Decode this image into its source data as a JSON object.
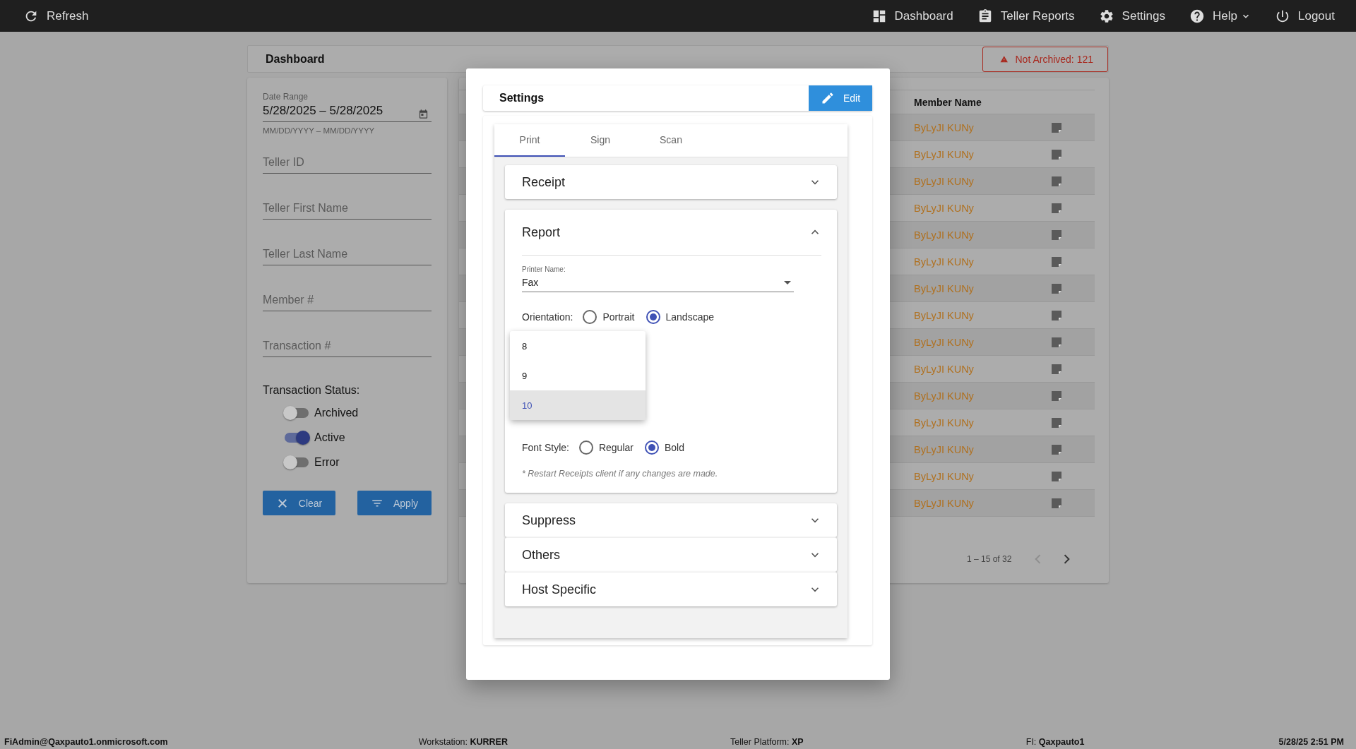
{
  "top_bar": {
    "refresh": "Refresh",
    "nav": [
      {
        "label": "Dashboard",
        "kind": "dashboard"
      },
      {
        "label": "Teller Reports",
        "kind": "reports"
      },
      {
        "label": "Settings",
        "kind": "settings"
      },
      {
        "label": "Help",
        "kind": "help"
      },
      {
        "label": "Logout",
        "kind": "logout"
      }
    ]
  },
  "page_header": {
    "title": "Dashboard",
    "alert": "Not Archived: 121"
  },
  "filters": {
    "date_range": {
      "label": "Date Range",
      "value": "5/28/2025 – 5/28/2025",
      "hint": "MM/DD/YYYY – MM/DD/YYYY"
    },
    "fields": [
      {
        "placeholder": "Teller ID"
      },
      {
        "placeholder": "Teller First Name"
      },
      {
        "placeholder": "Teller Last Name"
      },
      {
        "placeholder": "Member #"
      },
      {
        "placeholder": "Transaction #"
      }
    ],
    "status_label": "Transaction Status:",
    "toggles": [
      {
        "label": "Archived",
        "on": false
      },
      {
        "label": "Active",
        "on": true
      },
      {
        "label": "Error",
        "on": false
      }
    ],
    "buttons": [
      {
        "label": "Clear",
        "kind": "clear"
      },
      {
        "label": "Apply",
        "kind": "apply"
      }
    ]
  },
  "table": {
    "columns": [
      "Member Name"
    ],
    "rows": [
      {
        "member_name": "ByLyJI KUNy"
      },
      {
        "member_name": "ByLyJI KUNy"
      },
      {
        "member_name": "ByLyJI KUNy"
      },
      {
        "member_name": "ByLyJI KUNy"
      },
      {
        "member_name": "ByLyJI KUNy"
      },
      {
        "member_name": "ByLyJI KUNy"
      },
      {
        "member_name": "ByLyJI KUNy"
      },
      {
        "member_name": "ByLyJI KUNy"
      },
      {
        "member_name": "ByLyJI KUNy"
      },
      {
        "member_name": "ByLyJI KUNy"
      },
      {
        "member_name": "ByLyJI KUNy"
      },
      {
        "member_name": "ByLyJI KUNy"
      },
      {
        "member_name": "ByLyJI KUNy"
      },
      {
        "member_name": "ByLyJI KUNy"
      },
      {
        "member_name": "ByLyJI KUNy"
      }
    ],
    "pagination": {
      "range": "1 – 15 of 32",
      "previous_disabled": true,
      "next_disabled": false
    }
  },
  "settings_dialog": {
    "title": "Settings",
    "edit_button": "Edit",
    "tabs": [
      {
        "label": "Print",
        "selected": true
      },
      {
        "label": "Sign",
        "selected": false
      },
      {
        "label": "Scan",
        "selected": false
      }
    ],
    "sections": [
      {
        "title": "Receipt",
        "expanded": false
      },
      {
        "title": "Report",
        "expanded": true,
        "content": {
          "printer_label": "Printer Name:",
          "printer_value": "Fax",
          "orientation": {
            "label": "Orientation:",
            "options": [
              {
                "label": "Portrait",
                "selected": false
              },
              {
                "label": "Landscape",
                "selected": true
              }
            ]
          },
          "font_size_menu": [
            {
              "label": "8",
              "selected": false
            },
            {
              "label": "9",
              "selected": false
            },
            {
              "label": "10",
              "selected": true
            }
          ],
          "font_style": {
            "label": "Font Style:",
            "options": [
              {
                "label": "Regular",
                "selected": false
              },
              {
                "label": "Bold",
                "selected": true
              }
            ]
          },
          "note": "* Restart Receipts client if any changes are made."
        }
      },
      {
        "title": "Suppress",
        "expanded": false
      },
      {
        "title": "Others",
        "expanded": false
      },
      {
        "title": "Host Specific",
        "expanded": false
      }
    ]
  },
  "status_bar": [
    {
      "value": "FiAdmin@Qaxpauto1.onmicrosoft.com"
    },
    {
      "label": "Workstation:",
      "value": "KURRER"
    },
    {
      "label": "Teller Platform:",
      "value": "XP"
    },
    {
      "label": "FI:",
      "value": "Qaxpauto1"
    },
    {
      "value": "5/28/25 2:51 PM"
    }
  ]
}
